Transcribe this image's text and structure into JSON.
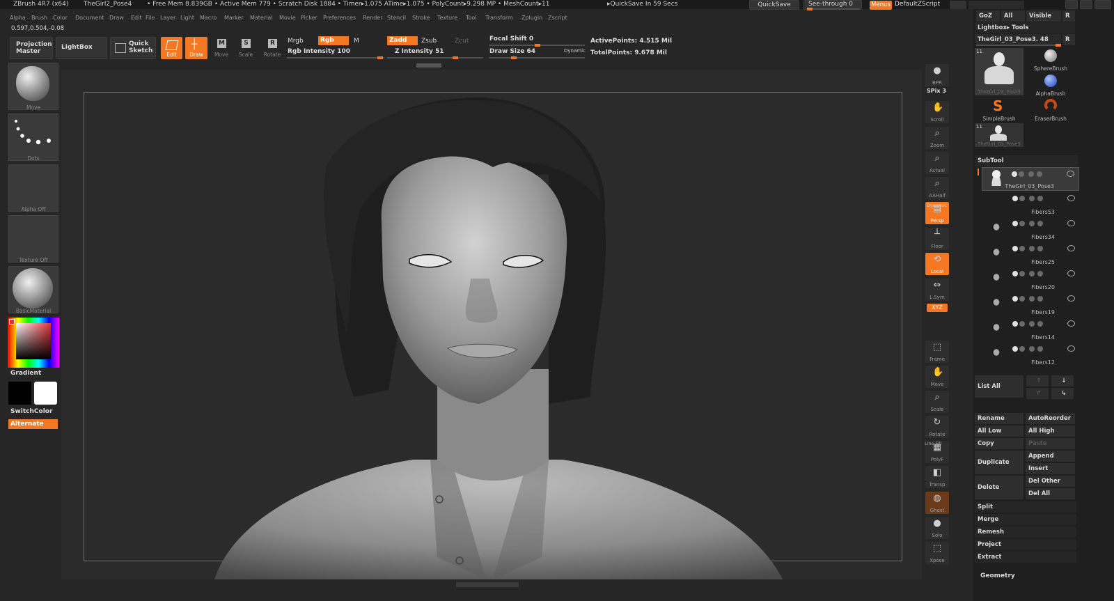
{
  "titlebar": {
    "app": "ZBrush 4R7 (x64)",
    "doc": "TheGirl2_Pose4",
    "stats": "• Free Mem 8.839GB • Active Mem 779 • Scratch Disk 1884 •  Timer▸1.075 ATime▸1.075 • PolyCount▸9.298 MP • MeshCount▸11",
    "quicksave_info": "▸QuickSave In 59 Secs",
    "quicksave": "QuickSave",
    "seethrough": "See-through  0",
    "menus": "Menus",
    "script": "DefaultZScript"
  },
  "menu": [
    "Alpha",
    "Brush",
    "Color",
    "Document",
    "Draw",
    "Edit",
    "File",
    "Layer",
    "Light",
    "Macro",
    "Marker",
    "Material",
    "Movie",
    "Picker",
    "Preferences",
    "Render",
    "Stencil",
    "Stroke",
    "Texture",
    "Tool",
    "Transform",
    "Zplugin",
    "Zscript"
  ],
  "coords": "0.597,0.504,-0.08",
  "toolbar": {
    "projection_master": "Projection Master",
    "lightbox": "LightBox",
    "quick_sketch": "Quick Sketch",
    "edit": "Edit",
    "draw": "Draw",
    "move": "Move",
    "scale": "Scale",
    "rotate": "Rotate",
    "mrgb": "Mrgb",
    "rgb": "Rgb",
    "m": "M",
    "rgb_intensity": "Rgb Intensity 100",
    "zadd": "Zadd",
    "zsub": "Zsub",
    "zcut": "Zcut",
    "z_intensity": "Z Intensity 51",
    "focal_shift": "Focal Shift 0",
    "draw_size": "Draw Size 64",
    "dynamic": "Dynamic",
    "active_points": "ActivePoints: 4.515  Mil",
    "total_points": "TotalPoints: 9.678  Mil"
  },
  "left": {
    "brush": "Move",
    "stroke": "Dots",
    "alpha": "Alpha  Off",
    "texture": "Texture  Off",
    "material": "BasicMaterial",
    "gradient": "Gradient",
    "switch_color": "SwitchColor",
    "alternate": "Alternate"
  },
  "right_tools": [
    {
      "id": "bpr",
      "label": "BPR"
    },
    {
      "id": "scroll",
      "label": "Scroll"
    },
    {
      "id": "zoom",
      "label": "Zoom"
    },
    {
      "id": "actual",
      "label": "Actual"
    },
    {
      "id": "aahalf",
      "label": "AAHalf"
    },
    {
      "id": "persp",
      "label": "Persp"
    },
    {
      "id": "floor",
      "label": "Floor"
    },
    {
      "id": "local",
      "label": "Local"
    },
    {
      "id": "lsym",
      "label": "L.Sym"
    },
    {
      "id": "frame",
      "label": "Frame"
    },
    {
      "id": "move",
      "label": "Move"
    },
    {
      "id": "scale",
      "label": "Scale"
    },
    {
      "id": "rotate",
      "label": "Rotate"
    },
    {
      "id": "polyf",
      "label": "PolyF"
    },
    {
      "id": "transp",
      "label": "Transp"
    },
    {
      "id": "ghost",
      "label": "Ghost"
    },
    {
      "id": "solo",
      "label": "Solo"
    },
    {
      "id": "xpose",
      "label": "Xpose"
    }
  ],
  "right_extra": {
    "spix": "SPix 3",
    "dynamic": "Dynamic",
    "xyz": "XYZ",
    "line_fill": "Line Fill"
  },
  "panel": {
    "goz": "GoZ",
    "all": "All",
    "visible": "Visible",
    "r": "R",
    "lightbox_tools": "Lightbox▸ Tools",
    "current_tool": "TheGirl_03_Pose3. 48",
    "tools": [
      {
        "name": "TheGirl_03_Pose3",
        "count": "11"
      },
      {
        "name": "SphereBrush"
      },
      {
        "name": "AlphaBrush"
      },
      {
        "name": "SimpleBrush"
      },
      {
        "name": "EraserBrush"
      },
      {
        "name": "TheGirl_03_Pose3",
        "count": "11"
      }
    ],
    "subtool": "SubTool",
    "subtools": [
      "TheGirl_03_Pose3",
      "FibersS3",
      "Fibers34",
      "Fibers25",
      "Fibers20",
      "Fibers19",
      "Fibers14",
      "Fibers12"
    ],
    "list_all": "List  All",
    "buttons": {
      "rename": "Rename",
      "autoreorder": "AutoReorder",
      "all_low": "All Low",
      "all_high": "All High",
      "copy": "Copy",
      "paste": "Paste",
      "duplicate": "Duplicate",
      "append": "Append",
      "insert": "Insert",
      "delete": "Delete",
      "del_other": "Del Other",
      "del_all": "Del All",
      "split": "Split",
      "merge": "Merge",
      "remesh": "Remesh",
      "project": "Project",
      "extract": "Extract"
    },
    "geometry": "Geometry"
  },
  "colors": {
    "accent": "#f47721",
    "bg": "#262626",
    "panel": "#1f1f1f",
    "canvas": "#2b2b2b"
  }
}
